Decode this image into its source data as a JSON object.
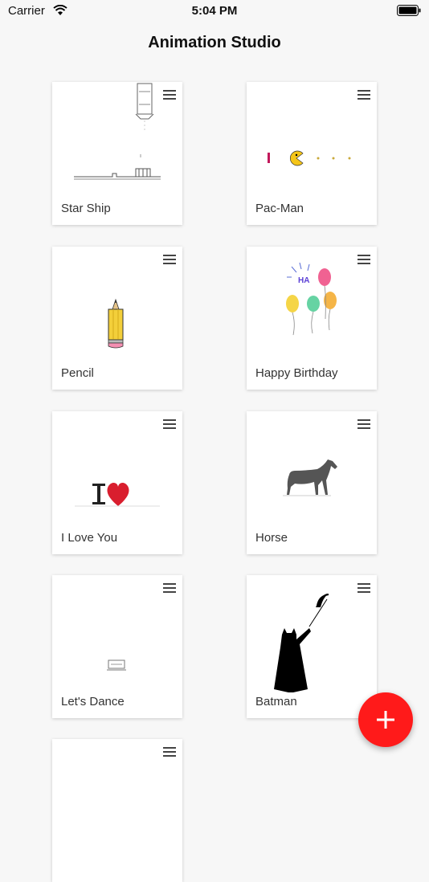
{
  "status": {
    "carrier": "Carrier",
    "time": "5:04 PM"
  },
  "header": {
    "title": "Animation Studio"
  },
  "animations": [
    {
      "name": "Star Ship"
    },
    {
      "name": "Pac-Man"
    },
    {
      "name": "Pencil"
    },
    {
      "name": "Happy Birthday"
    },
    {
      "name": "I Love You"
    },
    {
      "name": "Horse"
    },
    {
      "name": "Let's Dance"
    },
    {
      "name": "Batman"
    }
  ],
  "fab": {
    "icon": "plus-icon",
    "color": "#ff1a1a"
  }
}
